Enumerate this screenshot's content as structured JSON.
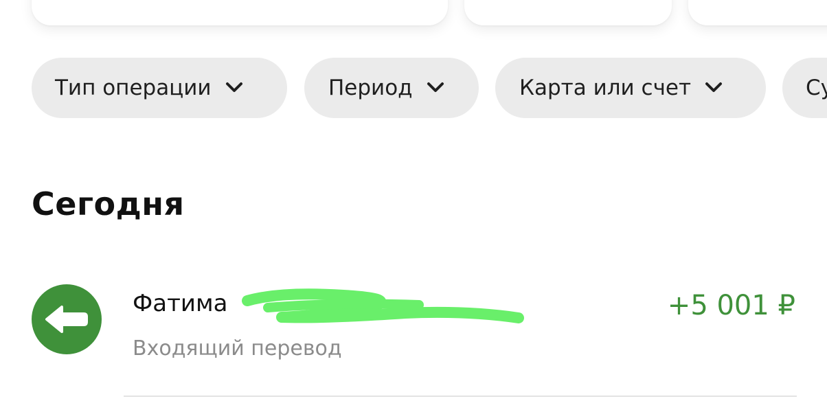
{
  "filters": [
    {
      "label": "Тип операции"
    },
    {
      "label": "Период"
    },
    {
      "label": "Карта или счет"
    },
    {
      "label": "Су"
    }
  ],
  "section": {
    "title": "Сегодня"
  },
  "transaction": {
    "name": "Фатима",
    "type": "Входящий перевод",
    "amount": "+5 001 ₽",
    "icon": "arrow-left-icon"
  },
  "colors": {
    "accent_green": "#3f913a",
    "chip_bg": "#ebebeb",
    "redaction_scribble": "#69ef6a",
    "muted_text": "#8b8b8b"
  }
}
